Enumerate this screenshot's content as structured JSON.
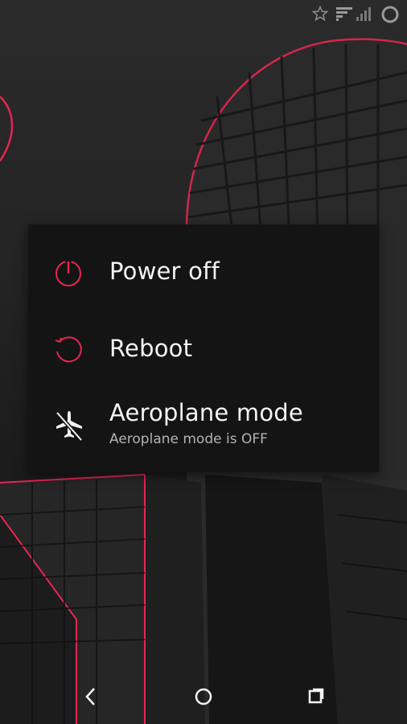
{
  "colors": {
    "accent": "#e5264f",
    "dialog_bg": "#141414",
    "text_primary": "#f4f4f4",
    "text_secondary": "#b3b3b3"
  },
  "status_bar": {
    "icons": [
      "star-icon",
      "wifi-icon",
      "signal-icon",
      "loading-ring-icon"
    ]
  },
  "power_menu": {
    "items": [
      {
        "icon": "power-icon",
        "label": "Power off"
      },
      {
        "icon": "reboot-icon",
        "label": "Reboot"
      },
      {
        "icon": "airplane-off-icon",
        "label": "Aeroplane mode",
        "subtitle": "Aeroplane mode is OFF"
      }
    ]
  },
  "nav_bar": {
    "buttons": [
      "back-icon",
      "home-icon",
      "recents-icon"
    ]
  }
}
